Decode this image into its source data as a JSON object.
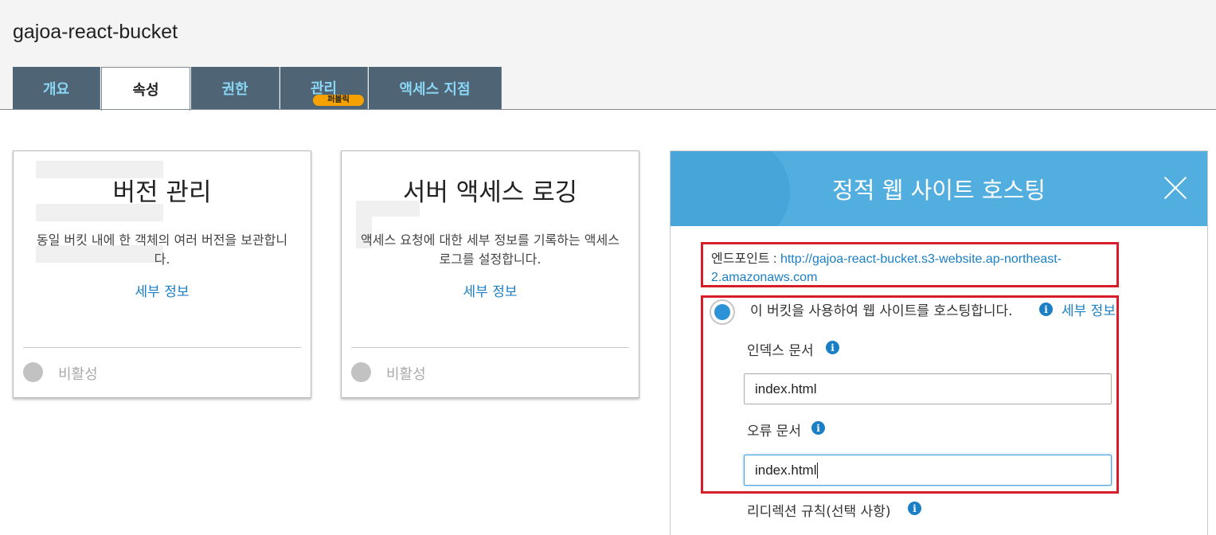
{
  "bucket": {
    "name": "gajoa-react-bucket"
  },
  "tabs": [
    {
      "label": "개요"
    },
    {
      "label": "속성"
    },
    {
      "label": "권한"
    },
    {
      "label": "관리"
    },
    {
      "label": "액세스 지점"
    }
  ],
  "tab_badge": "퍼블릭",
  "cards": [
    {
      "title": "버전 관리",
      "desc": "동일 버킷 내에 한 객체의 여러 버전을 보관합니다.",
      "link": "세부 정보",
      "status": "비활성"
    },
    {
      "title": "서버 액세스 로깅",
      "desc": "액세스 요청에 대한 세부 정보를 기록하는 액세스 로그를 설정합니다.",
      "link": "세부 정보",
      "status": "비활성"
    }
  ],
  "hosting": {
    "title": "정적 웹 사이트 호스팅",
    "endpoint_label": "엔드포인트 :",
    "endpoint_url": "http://gajoa-react-bucket.s3-website.ap-northeast-2.amazonaws.com",
    "option_label": "이 버킷을 사용하여 웹 사이트를 호스팅합니다.",
    "option_link": "세부 정보",
    "index_label": "인덱스 문서",
    "index_value": "index.html",
    "error_label": "오류 문서",
    "error_value": "index.html",
    "redirect_label": "리디렉션 규칙(선택 사항)"
  },
  "colors": {
    "accent": "#1a7fc4",
    "tab_bg": "#4f6474",
    "header_blue": "#53aee0",
    "highlight_red": "#d71e2a",
    "badge": "#f5a200"
  },
  "icons": {
    "info": "info-icon",
    "close": "close-icon"
  }
}
